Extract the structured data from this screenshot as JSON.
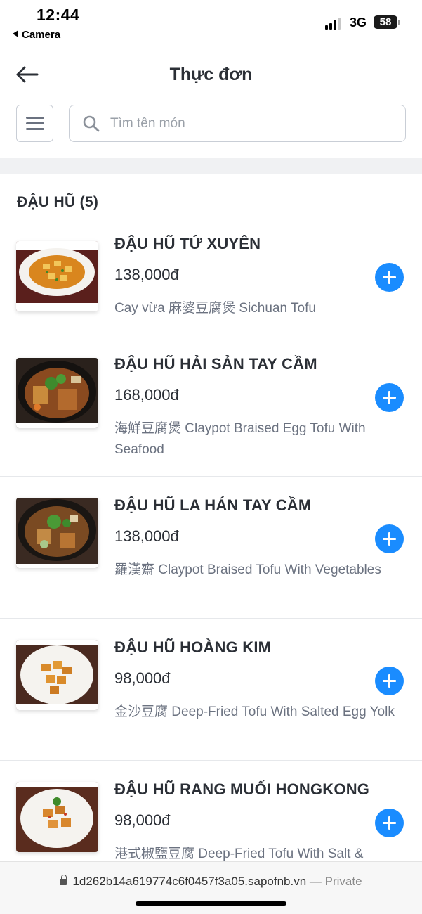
{
  "status_bar": {
    "time": "12:44",
    "back_app": "Camera",
    "network": "3G",
    "battery": "58"
  },
  "header": {
    "title": "Thực đơn",
    "back_icon": "arrow-left-icon"
  },
  "search": {
    "placeholder": "Tìm tên món",
    "value": ""
  },
  "category": {
    "title": "ĐẬU HŨ (5)"
  },
  "items": [
    {
      "name": "ĐẬU HŨ TỨ XUYÊN",
      "price": "138,000đ",
      "description": "Cay vừa 麻婆豆腐煲 Sichuan Tofu"
    },
    {
      "name": "ĐẬU HŨ HẢI SẢN TAY CẦM",
      "price": "168,000đ",
      "description": "海鮮豆腐煲 Claypot Braised Egg Tofu With Seafood"
    },
    {
      "name": "ĐẬU HŨ LA HÁN TAY CẦM",
      "price": "138,000đ",
      "description": "羅漢齋 Claypot Braised Tofu With Vegetables"
    },
    {
      "name": "ĐẬU HŨ HOÀNG KIM",
      "price": "98,000đ",
      "description": "金沙豆腐 Deep-Fried Tofu With Salted Egg Yolk"
    },
    {
      "name": "ĐẬU HŨ RANG MUỐI HONGKONG",
      "price": "98,000đ",
      "description": "港式椒鹽豆腐 Deep-Fried Tofu With Salt &"
    }
  ],
  "url_bar": {
    "url": "1d262b14a619774c6f0457f3a05.sapofnb.vn",
    "suffix": "— Private"
  },
  "colors": {
    "accent": "#1a8cff",
    "text": "#2b2f36",
    "muted": "#6b7280"
  }
}
